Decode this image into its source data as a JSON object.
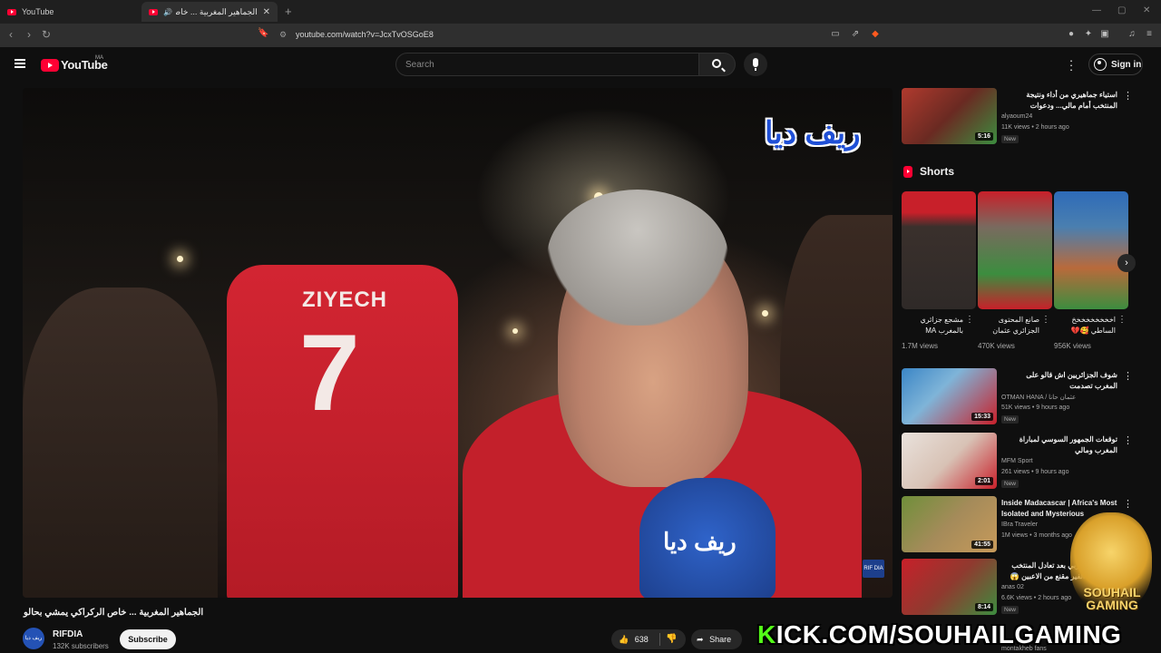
{
  "browser": {
    "tabs": [
      {
        "title": "YouTube"
      },
      {
        "title": "الجماهير المغربية ... خاص الركـ"
      }
    ],
    "url": "youtube.com/watch?v=JcxTvOSGoE8"
  },
  "header": {
    "logo_text": "YouTube",
    "country": "MA",
    "search_placeholder": "Search",
    "signin_label": "Sign in"
  },
  "player": {
    "jersey_name": "ZIYECH",
    "jersey_number": "7",
    "mic_logo": "ريف ديا",
    "watermark": "ريف ديا",
    "corner_badge": "RIF DIA"
  },
  "video": {
    "title": "الجماهير المغربية ... خاص الركراكي يمشي بحالو",
    "channel_name": "RIFDIA",
    "avatar_text": "ريف ديا",
    "subscribers": "132K subscribers",
    "subscribe_label": "Subscribe",
    "likes": "638",
    "share_label": "Share"
  },
  "sidebar": {
    "top_videos": [
      {
        "title": "استياء جماهيري من أداء ونتيجة المنتخب أمام مالي... ودعوات للركراكي للاعتماد على",
        "channel": "alyaoum24",
        "views": "11K views",
        "age": "2 hours ago",
        "badge": "New",
        "duration": "5:16",
        "colors": [
          "#b03a2e",
          "#3c8d3f"
        ]
      }
    ],
    "shorts_label": "Shorts",
    "shorts": [
      {
        "title": "مشجع جزائري بالمغرب MA",
        "views": "1.7M views",
        "colors": [
          "#c8202a",
          "#2f2a28"
        ]
      },
      {
        "title": "صانع المحتوى الجزائري عثمان",
        "views": "470K views",
        "colors": [
          "#3c8d3f",
          "#c8202a"
        ]
      },
      {
        "title": "اخخخخخخخخخ الساطي 🥰💔",
        "views": "956K views",
        "colors": [
          "#2e6bb8",
          "#b96a3b"
        ]
      }
    ],
    "more_videos": [
      {
        "title": "شوف الجزائريين اش قالو على المغرب تصدمت",
        "channel": "OTMAN HANA / عثمان حانا",
        "views": "51K views",
        "age": "9 hours ago",
        "badge": "New",
        "duration": "15:33",
        "colors": [
          "#3b86c6",
          "#c8202a"
        ],
        "rtl": true
      },
      {
        "title": "توقعات الجمهور السوسي لمباراة المغرب ومالي",
        "channel": "MFM Sport",
        "views": "261 views",
        "age": "9 hours ago",
        "badge": "New",
        "duration": "2:01",
        "colors": [
          "#e9e2dc",
          "#c8202a"
        ],
        "rtl": true
      },
      {
        "title": "Inside Madacascar | Africa's Most Isolated and Mysterious",
        "channel": "IBra Traveler",
        "views": "1M views",
        "age": "3 months ago",
        "badge": "",
        "duration": "41:55",
        "colors": [
          "#6f8f3a",
          "#c79a5a"
        ],
        "rtl": false
      },
      {
        "title": "الجمهور المغربي بعد تعادل المنتخب بسبب أداء الفير مقنع من الاعبين 😱",
        "channel": "anas 02",
        "views": "6.6K views",
        "age": "2 hours ago",
        "badge": "New",
        "duration": "8:14",
        "colors": [
          "#c8202a",
          "#3c8d3f"
        ],
        "rtl": true
      }
    ],
    "partial_channel": "montakheb fans"
  },
  "overlay": {
    "kick_k": "K",
    "kick_text": "ICK.COM/SOUHAILGAMING",
    "logo_text_1": "SOUHAIL",
    "logo_text_2": "GAMING"
  }
}
